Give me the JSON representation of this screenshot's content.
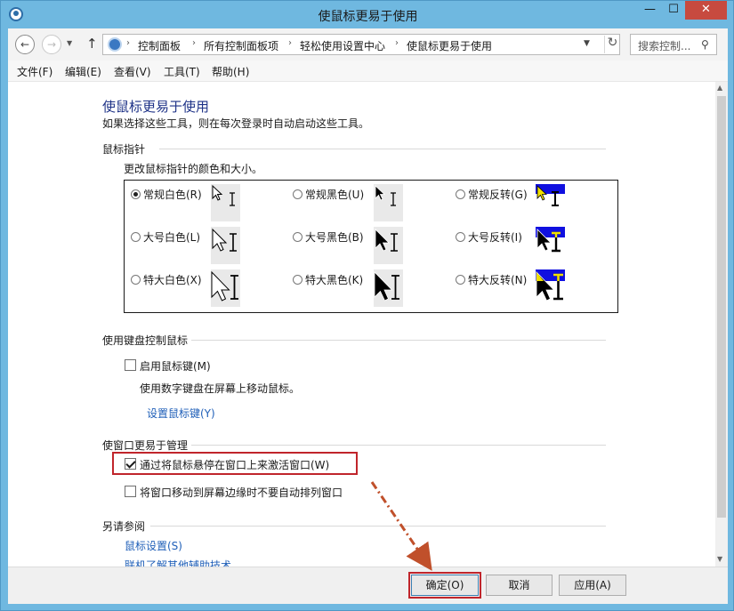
{
  "window": {
    "title": "使鼠标更易于使用",
    "minimize": "—",
    "maximize": "☐",
    "close": "✕"
  },
  "address": {
    "crumbs": [
      "控制面板",
      "所有控制面板项",
      "轻松使用设置中心",
      "使鼠标更易于使用"
    ],
    "search_placeholder": "搜索控制..."
  },
  "menu": [
    "文件(F)",
    "编辑(E)",
    "查看(V)",
    "工具(T)",
    "帮助(H)"
  ],
  "page": {
    "title": "使鼠标更易于使用",
    "description": "如果选择这些工具，则在每次登录时自动启动这些工具。"
  },
  "pointer_section": {
    "heading": "鼠标指针",
    "subtitle": "更改鼠标指针的颜色和大小。",
    "options": [
      {
        "label": "常规白色(R)",
        "checked": true
      },
      {
        "label": "常规黑色(U)",
        "checked": false
      },
      {
        "label": "常规反转(G)",
        "checked": false
      },
      {
        "label": "大号白色(L)",
        "checked": false
      },
      {
        "label": "大号黑色(B)",
        "checked": false
      },
      {
        "label": "大号反转(I)",
        "checked": false
      },
      {
        "label": "特大白色(X)",
        "checked": false
      },
      {
        "label": "特大黑色(K)",
        "checked": false
      },
      {
        "label": "特大反转(N)",
        "checked": false
      }
    ]
  },
  "keyboard_section": {
    "heading": "使用键盘控制鼠标",
    "checkbox_label": "启用鼠标键(M)",
    "checkbox_checked": false,
    "description": "使用数字键盘在屏幕上移动鼠标。",
    "link": "设置鼠标键(Y)"
  },
  "window_section": {
    "heading": "使窗口更易于管理",
    "option1_label": "通过将鼠标悬停在窗口上来激活窗口(W)",
    "option1_checked": true,
    "option2_label": "将窗口移动到屏幕边缘时不要自动排列窗口",
    "option2_checked": false
  },
  "see_also": {
    "heading": "另请参阅",
    "links": [
      "鼠标设置(S)",
      "联机了解其他辅助技术"
    ]
  },
  "buttons": {
    "ok": "确定(O)",
    "cancel": "取消",
    "apply": "应用(A)"
  },
  "colors": {
    "title_bar": "#6fb8e0",
    "link": "#1f5fb8",
    "page_title": "#1e3287",
    "highlight": "#c0252b",
    "annotation_arrow": "#c0502b"
  }
}
